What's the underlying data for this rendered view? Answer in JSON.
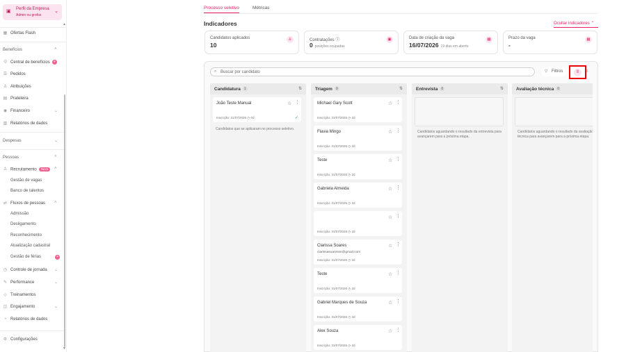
{
  "sidebar": {
    "profile": {
      "title": "Perfil da Empresa",
      "subtitle": "Admin ou grofos"
    },
    "items": [
      {
        "label": "Ofertas Flash",
        "icon": "grid-icon"
      },
      {
        "label": "Benefícios"
      },
      {
        "label": "Central de benefícios",
        "badge": "+"
      },
      {
        "label": "Pedidos"
      },
      {
        "label": "Atribuições"
      },
      {
        "label": "Prateleira"
      },
      {
        "label": "Financeiro"
      },
      {
        "label": "Relatórios de dados"
      },
      {
        "label": "Despesas"
      },
      {
        "label": "Pessoas"
      },
      {
        "label": "Recrutamento",
        "badge": "Novo"
      },
      {
        "label": "Gestão de vagas"
      },
      {
        "label": "Banco de talentos"
      },
      {
        "label": "Fluxos de pessoas"
      },
      {
        "label": "Admissão"
      },
      {
        "label": "Desligamento"
      },
      {
        "label": "Reconhecimento"
      },
      {
        "label": "Atualização cadastral"
      },
      {
        "label": "Gestão de férias",
        "badge": "+"
      },
      {
        "label": "Controle de jornada"
      },
      {
        "label": "Performance"
      },
      {
        "label": "Treinamentos"
      },
      {
        "label": "Engajamento"
      },
      {
        "label": "Relatórios de dados"
      },
      {
        "label": "Configurações"
      }
    ]
  },
  "tabs": [
    {
      "label": "Processo seletivo",
      "active": true
    },
    {
      "label": "Métricas",
      "active": false
    }
  ],
  "indicators": {
    "title": "Indicadores",
    "hide_label": "Ocultar indicadores",
    "cards": [
      {
        "label": "Candidatos aplicados",
        "value": "10",
        "sub": ""
      },
      {
        "label": "Contratações ⓘ",
        "value": "0",
        "sub": "posições ocupadas"
      },
      {
        "label": "Data de criação da vaga",
        "value": "16/07/2026",
        "sub": "19 dias em aberto"
      },
      {
        "label": "Prazo da vaga",
        "value": "-",
        "sub": ""
      }
    ]
  },
  "toolbar": {
    "search_placeholder": "Buscar por candidato",
    "filters_label": "Filtros"
  },
  "columns": [
    {
      "name": "Candidatura",
      "count": "1",
      "note": "Candidatos que se aplicaram no processo seletivo.",
      "cards": [
        {
          "name": "João Teste Manual",
          "email": "",
          "date": "Inscrição: 31/07/2026 ◷ 0d"
        }
      ]
    },
    {
      "name": "Triagem",
      "count": "9",
      "cards": [
        {
          "name": "Michael Gary Scott",
          "email": "",
          "date": "Inscrição: 31/07/2026 ◷ 2d"
        },
        {
          "name": "Flavia Mingo",
          "email": "",
          "date": "Inscrição: 31/07/2026 ◷ 2d"
        },
        {
          "name": "Teste",
          "email": "",
          "date": "Inscrição: 31/07/2026 ◷ 2d"
        },
        {
          "name": "Gabriela Almeida",
          "email": "",
          "date": "Inscrição: 31/07/2026 ◷ 2d"
        },
        {
          "name": "",
          "email": "",
          "date": "Inscrição: 31/07/2026 ◷ 2d"
        },
        {
          "name": "Clarissa Soares",
          "email": "clarissasoaresss@gmail.com",
          "date": "Inscrição: 31/07/2026 ◷ 2d"
        },
        {
          "name": "Teste",
          "email": "",
          "date": "Inscrição: 31/07/2026 ◷ 2d"
        },
        {
          "name": "Gabriel Marques de Souza",
          "email": "",
          "date": "Inscrição: 31/07/2026 ◷ 2d"
        },
        {
          "name": "Alex Souza",
          "email": "",
          "date": "Inscrição: 31/07/2026 ◷ 2d"
        }
      ]
    },
    {
      "name": "Entrevista",
      "count": "0",
      "note": "Candidatos aguardando o resultado da entrevista para avançarem para a próxima etapa.",
      "cards": []
    },
    {
      "name": "Avaliação técnica",
      "count": "0",
      "note": "Candidatos aguardando o resultado da avaliação técnica para avançarem para a próxima etapa.",
      "cards": []
    }
  ]
}
